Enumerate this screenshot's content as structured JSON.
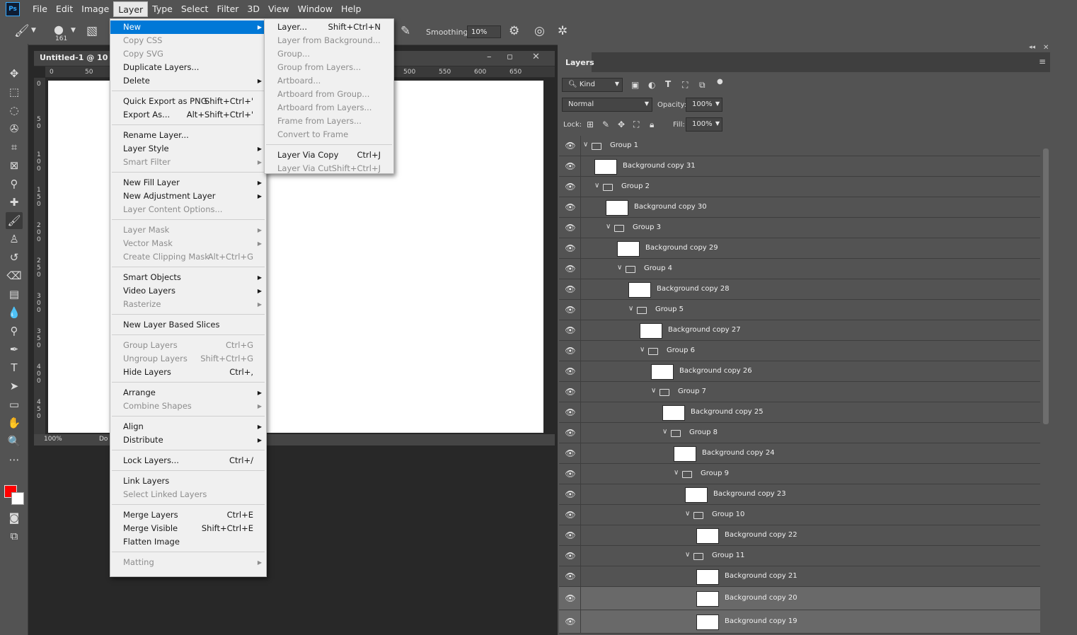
{
  "menubar": {
    "items": [
      "File",
      "Edit",
      "Image",
      "Layer",
      "Type",
      "Select",
      "Filter",
      "3D",
      "View",
      "Window",
      "Help"
    ],
    "active": "Layer",
    "logo": "Ps"
  },
  "options": {
    "brush_size": "161",
    "smoothing_label": "Smoothing:",
    "smoothing_value": "10%"
  },
  "document": {
    "title": "Untitled-1 @ 10",
    "zoom": "100%",
    "status_text": "Do",
    "ruler_top": [
      "0",
      "50",
      "500",
      "550",
      "600",
      "650"
    ],
    "ruler_left": [
      "0",
      "5 0",
      "1 0 0",
      "1 5 0",
      "2 0 0",
      "2 5 0",
      "3 0 0",
      "3 5 0",
      "4 0 0",
      "4 5 0"
    ]
  },
  "layer_menu": {
    "items": [
      {
        "label": "New",
        "submenu": true,
        "highlight": true
      },
      {
        "label": "Copy CSS",
        "disabled": true
      },
      {
        "label": "Copy SVG",
        "disabled": true
      },
      {
        "label": "Duplicate Layers..."
      },
      {
        "label": "Delete",
        "submenu": true
      },
      {
        "sep": true
      },
      {
        "label": "Quick Export as PNG",
        "shortcut": "Shift+Ctrl+'"
      },
      {
        "label": "Export As...",
        "shortcut": "Alt+Shift+Ctrl+'"
      },
      {
        "sep": true
      },
      {
        "label": "Rename Layer..."
      },
      {
        "label": "Layer Style",
        "submenu": true
      },
      {
        "label": "Smart Filter",
        "submenu": true,
        "disabled": true
      },
      {
        "sep": true
      },
      {
        "label": "New Fill Layer",
        "submenu": true
      },
      {
        "label": "New Adjustment Layer",
        "submenu": true
      },
      {
        "label": "Layer Content Options...",
        "disabled": true
      },
      {
        "sep": true
      },
      {
        "label": "Layer Mask",
        "submenu": true,
        "disabled": true
      },
      {
        "label": "Vector Mask",
        "submenu": true,
        "disabled": true
      },
      {
        "label": "Create Clipping Mask",
        "shortcut": "Alt+Ctrl+G",
        "disabled": true
      },
      {
        "sep": true
      },
      {
        "label": "Smart Objects",
        "submenu": true
      },
      {
        "label": "Video Layers",
        "submenu": true
      },
      {
        "label": "Rasterize",
        "submenu": true,
        "disabled": true
      },
      {
        "sep": true
      },
      {
        "label": "New Layer Based Slices"
      },
      {
        "sep": true
      },
      {
        "label": "Group Layers",
        "shortcut": "Ctrl+G",
        "disabled": true
      },
      {
        "label": "Ungroup Layers",
        "shortcut": "Shift+Ctrl+G",
        "disabled": true
      },
      {
        "label": "Hide Layers",
        "shortcut": "Ctrl+,"
      },
      {
        "sep": true
      },
      {
        "label": "Arrange",
        "submenu": true
      },
      {
        "label": "Combine Shapes",
        "submenu": true,
        "disabled": true
      },
      {
        "sep": true
      },
      {
        "label": "Align",
        "submenu": true
      },
      {
        "label": "Distribute",
        "submenu": true
      },
      {
        "sep": true
      },
      {
        "label": "Lock Layers...",
        "shortcut": "Ctrl+/"
      },
      {
        "sep": true
      },
      {
        "label": "Link Layers"
      },
      {
        "label": "Select Linked Layers",
        "disabled": true
      },
      {
        "sep": true
      },
      {
        "label": "Merge Layers",
        "shortcut": "Ctrl+E"
      },
      {
        "label": "Merge Visible",
        "shortcut": "Shift+Ctrl+E"
      },
      {
        "label": "Flatten Image"
      },
      {
        "sep": true
      },
      {
        "label": "Matting",
        "submenu": true,
        "disabled": true
      }
    ]
  },
  "new_submenu": {
    "items": [
      {
        "label": "Layer...",
        "shortcut": "Shift+Ctrl+N"
      },
      {
        "label": "Layer from Background...",
        "disabled": true
      },
      {
        "label": "Group...",
        "disabled": true
      },
      {
        "label": "Group from Layers...",
        "disabled": true
      },
      {
        "label": "Artboard...",
        "disabled": true
      },
      {
        "label": "Artboard from Group...",
        "disabled": true
      },
      {
        "label": "Artboard from Layers...",
        "disabled": true
      },
      {
        "label": "Frame from Layers...",
        "disabled": true
      },
      {
        "label": "Convert to Frame",
        "disabled": true
      },
      {
        "sep": true
      },
      {
        "label": "Layer Via Copy",
        "shortcut": "Ctrl+J"
      },
      {
        "label": "Layer Via Cut",
        "shortcut": "Shift+Ctrl+J",
        "disabled": true
      }
    ]
  },
  "layers_panel": {
    "tab": "Layers",
    "filter_kind": "Kind",
    "blend_mode": "Normal",
    "opacity_label": "Opacity:",
    "opacity": "100%",
    "lock_label": "Lock:",
    "fill_label": "Fill:",
    "fill": "100%",
    "layers": [
      {
        "name": "Group 1",
        "type": "group",
        "depth": 0
      },
      {
        "name": "Background copy 31",
        "type": "layer",
        "depth": 1
      },
      {
        "name": "Group 2",
        "type": "group",
        "depth": 1
      },
      {
        "name": "Background copy 30",
        "type": "layer",
        "depth": 2
      },
      {
        "name": "Group 3",
        "type": "group",
        "depth": 2
      },
      {
        "name": "Background copy 29",
        "type": "layer",
        "depth": 3
      },
      {
        "name": "Group 4",
        "type": "group",
        "depth": 3
      },
      {
        "name": "Background copy 28",
        "type": "layer",
        "depth": 4
      },
      {
        "name": "Group 5",
        "type": "group",
        "depth": 4
      },
      {
        "name": "Background copy 27",
        "type": "layer",
        "depth": 5
      },
      {
        "name": "Group 6",
        "type": "group",
        "depth": 5
      },
      {
        "name": "Background copy 26",
        "type": "layer",
        "depth": 6
      },
      {
        "name": "Group 7",
        "type": "group",
        "depth": 6
      },
      {
        "name": "Background copy 25",
        "type": "layer",
        "depth": 7
      },
      {
        "name": "Group 8",
        "type": "group",
        "depth": 7
      },
      {
        "name": "Background copy 24",
        "type": "layer",
        "depth": 8
      },
      {
        "name": "Group 9",
        "type": "group",
        "depth": 8
      },
      {
        "name": "Background copy 23",
        "type": "layer",
        "depth": 9
      },
      {
        "name": "Group 10",
        "type": "group",
        "depth": 9
      },
      {
        "name": "Background copy 22",
        "type": "layer",
        "depth": 10
      },
      {
        "name": "Group 11",
        "type": "group",
        "depth": 9
      },
      {
        "name": "Background copy 21",
        "type": "layer",
        "depth": 10
      },
      {
        "name": "Background copy 20",
        "type": "layer",
        "depth": 10,
        "selected": true
      },
      {
        "name": "Background copy 19",
        "type": "layer",
        "depth": 10,
        "selected": true
      }
    ]
  },
  "colors": {
    "foreground": "#ff0000",
    "background": "#ffffff",
    "highlight": "#0078d7"
  }
}
